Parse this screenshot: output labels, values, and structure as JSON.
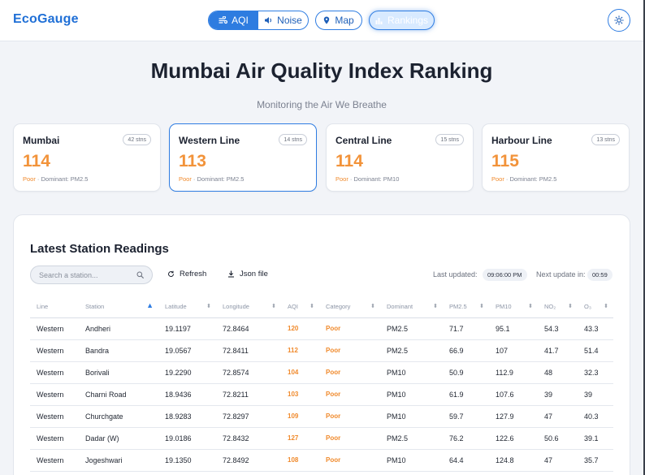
{
  "brand": "EcoGauge",
  "nav": {
    "aqi": "AQI",
    "noise": "Noise",
    "map": "Map",
    "rankings": "Rankings"
  },
  "page": {
    "title": "Mumbai Air Quality Index Ranking",
    "subtitle": "Monitoring the Air We Breathe"
  },
  "cards": [
    {
      "name": "Mumbai",
      "stations": "42 stns",
      "aqi": "114",
      "category": "Poor",
      "dominant": " · Dominant: PM2.5"
    },
    {
      "name": "Western Line",
      "stations": "14 stns",
      "aqi": "113",
      "category": "Poor",
      "dominant": " · Dominant: PM2.5"
    },
    {
      "name": "Central Line",
      "stations": "15 stns",
      "aqi": "114",
      "category": "Poor",
      "dominant": " · Dominant: PM10"
    },
    {
      "name": "Harbour Line",
      "stations": "13 stns",
      "aqi": "115",
      "category": "Poor",
      "dominant": " · Dominant: PM2.5"
    }
  ],
  "readings": {
    "title": "Latest Station Readings",
    "search_placeholder": "Search a station...",
    "refresh": "Refresh",
    "json": "Json file",
    "last_updated_label": "Last updated:",
    "last_updated": "09:06:00 PM",
    "next_update_label": "Next update in:",
    "next_update": "00:59",
    "columns": [
      "Line",
      "Station",
      "Latitude",
      "Longitude",
      "AQI",
      "Category",
      "Dominant",
      "PM2.5",
      "PM10",
      "NO₂",
      "O₃"
    ],
    "rows": [
      [
        "Western",
        "Andheri",
        "19.1197",
        "72.8464",
        "120",
        "Poor",
        "PM2.5",
        "71.7",
        "95.1",
        "54.3",
        "43.3"
      ],
      [
        "Western",
        "Bandra",
        "19.0567",
        "72.8411",
        "112",
        "Poor",
        "PM2.5",
        "66.9",
        "107",
        "41.7",
        "51.4"
      ],
      [
        "Western",
        "Borivali",
        "19.2290",
        "72.8574",
        "104",
        "Poor",
        "PM10",
        "50.9",
        "112.9",
        "48",
        "32.3"
      ],
      [
        "Western",
        "Charni Road",
        "18.9436",
        "72.8211",
        "103",
        "Poor",
        "PM10",
        "61.9",
        "107.6",
        "39",
        "39"
      ],
      [
        "Western",
        "Churchgate",
        "18.9283",
        "72.8297",
        "109",
        "Poor",
        "PM10",
        "59.7",
        "127.9",
        "47",
        "40.3"
      ],
      [
        "Western",
        "Dadar (W)",
        "19.0186",
        "72.8432",
        "127",
        "Poor",
        "PM2.5",
        "76.2",
        "122.6",
        "50.6",
        "39.1"
      ],
      [
        "Western",
        "Jogeshwari",
        "19.1350",
        "72.8492",
        "108",
        "Poor",
        "PM10",
        "64.4",
        "124.8",
        "47",
        "35.7"
      ]
    ]
  },
  "colors": {
    "accent": "#2f7de2",
    "brand": "#1f6fd6",
    "poor": "#f08a2c"
  },
  "icons": [
    "wind-icon",
    "sound-icon",
    "map-pin-icon",
    "bar-chart-icon",
    "sun-icon",
    "search-icon",
    "refresh-icon",
    "download-icon"
  ]
}
